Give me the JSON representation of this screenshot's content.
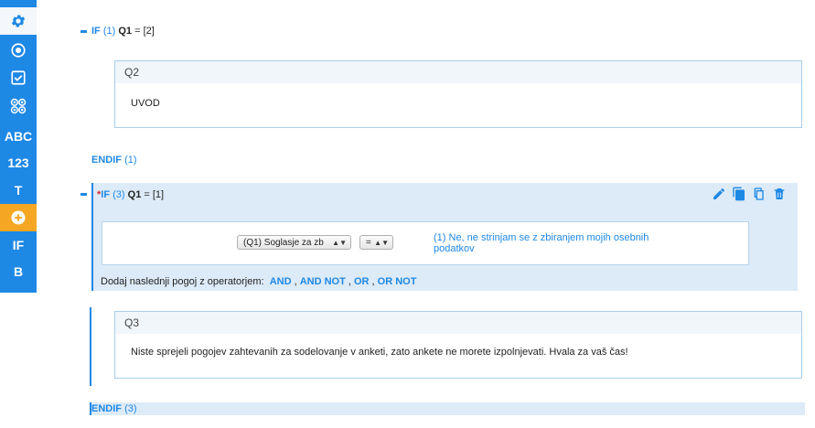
{
  "sidebar": {
    "items": [
      {
        "icon": "gear-icon",
        "label": ""
      },
      {
        "icon": "radio-icon",
        "label": ""
      },
      {
        "icon": "checkbox-icon",
        "label": ""
      },
      {
        "icon": "grid-circles-icon",
        "label": ""
      },
      {
        "icon": "",
        "label": "ABC"
      },
      {
        "icon": "",
        "label": "123"
      },
      {
        "icon": "",
        "label": "T"
      },
      {
        "icon": "plus-circle-icon",
        "label": ""
      },
      {
        "icon": "",
        "label": "IF"
      },
      {
        "icon": "",
        "label": "B"
      }
    ],
    "accent": "#1e88e5",
    "active_color": "#f5a623"
  },
  "block1": {
    "if_kw": "IF",
    "if_num": "(1)",
    "var": "Q1",
    "cond": "= [2]",
    "question": {
      "id": "Q2",
      "text": "UVOD"
    },
    "endif_kw": "ENDIF",
    "endif_num": "(1)"
  },
  "block2": {
    "star": "*",
    "if_kw": "IF",
    "if_num": "(3)",
    "var": "Q1",
    "cond": "= [1]",
    "select_question": "(Q1) Soglasje za zb",
    "select_operator": "=",
    "answer": "(1) Ne, ne strinjam se z zbiranjem mojih osebnih podatkov",
    "ops_label": "Dodaj naslednji pogoj z operatorjem:",
    "ops": [
      "AND",
      "AND NOT",
      "OR",
      "OR NOT"
    ],
    "question": {
      "id": "Q3",
      "text": "Niste sprejeli pogojev zahtevanih za sodelovanje v anketi, zato ankete ne morete izpolnjevati. Hvala za vaš čas!"
    },
    "endif_kw": "ENDIF",
    "endif_num": "(3)"
  }
}
